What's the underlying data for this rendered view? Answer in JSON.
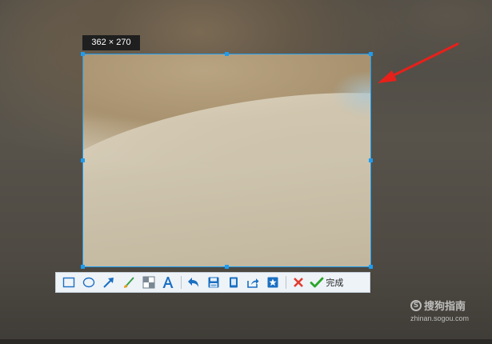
{
  "selection": {
    "size_label": "362 × 270"
  },
  "toolbar": {
    "tools": [
      {
        "name": "rectangle-tool",
        "icon": "rectangle-icon"
      },
      {
        "name": "ellipse-tool",
        "icon": "ellipse-icon"
      },
      {
        "name": "arrow-tool",
        "icon": "arrow-icon"
      },
      {
        "name": "brush-tool",
        "icon": "brush-icon"
      },
      {
        "name": "mosaic-tool",
        "icon": "mosaic-icon"
      },
      {
        "name": "text-tool",
        "icon": "text-icon"
      },
      {
        "name": "undo-tool",
        "icon": "undo-icon"
      },
      {
        "name": "save-tool",
        "icon": "save-icon"
      },
      {
        "name": "copy-tool",
        "icon": "copy-icon"
      },
      {
        "name": "share-tool",
        "icon": "share-icon"
      },
      {
        "name": "pin-tool",
        "icon": "pin-icon"
      },
      {
        "name": "cancel-tool",
        "icon": "close-icon"
      }
    ],
    "done_label": "完成"
  },
  "watermark": {
    "brand": "搜狗指南",
    "url": "zhinan.sogou.com"
  },
  "colors": {
    "selection_border": "#1e9cf0",
    "arrow": "#e8201a",
    "cancel": "#e23b2e",
    "done": "#2aa52a"
  }
}
